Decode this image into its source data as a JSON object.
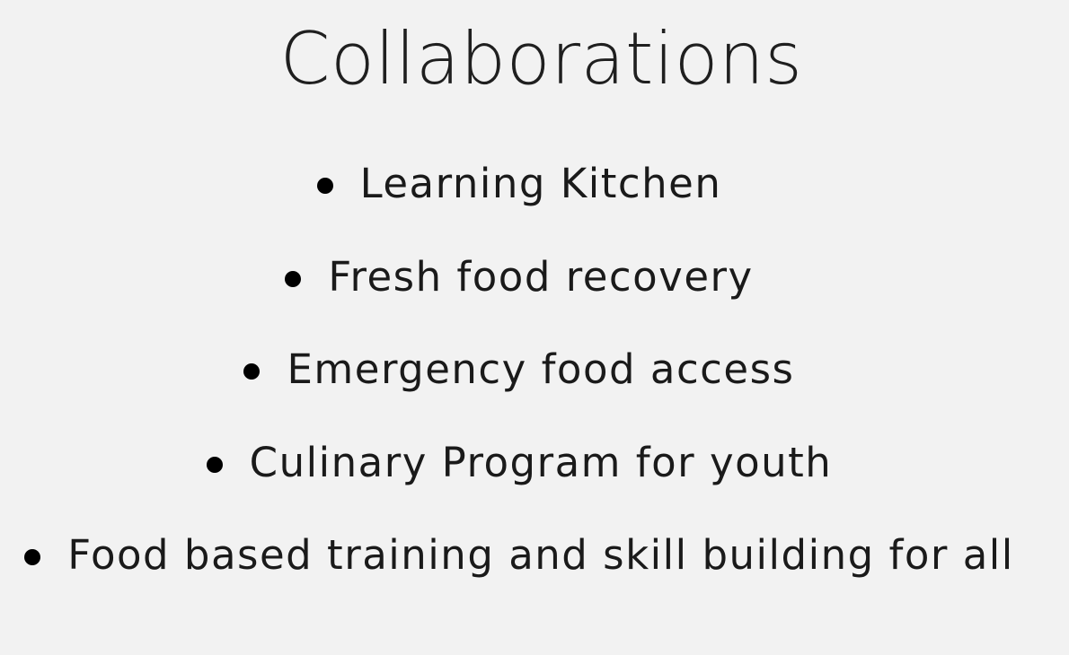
{
  "slide": {
    "title": "Collaborations",
    "bullets": [
      {
        "text": "Learning Kitchen"
      },
      {
        "text": "Fresh food recovery"
      },
      {
        "text": "Emergency food access"
      },
      {
        "text": "Culinary Program for youth"
      },
      {
        "text": "Food based training and skill building for all"
      }
    ]
  },
  "colors": {
    "background": "#f2f2f2",
    "text": "#1a1a1a",
    "bullet": "#000000"
  }
}
